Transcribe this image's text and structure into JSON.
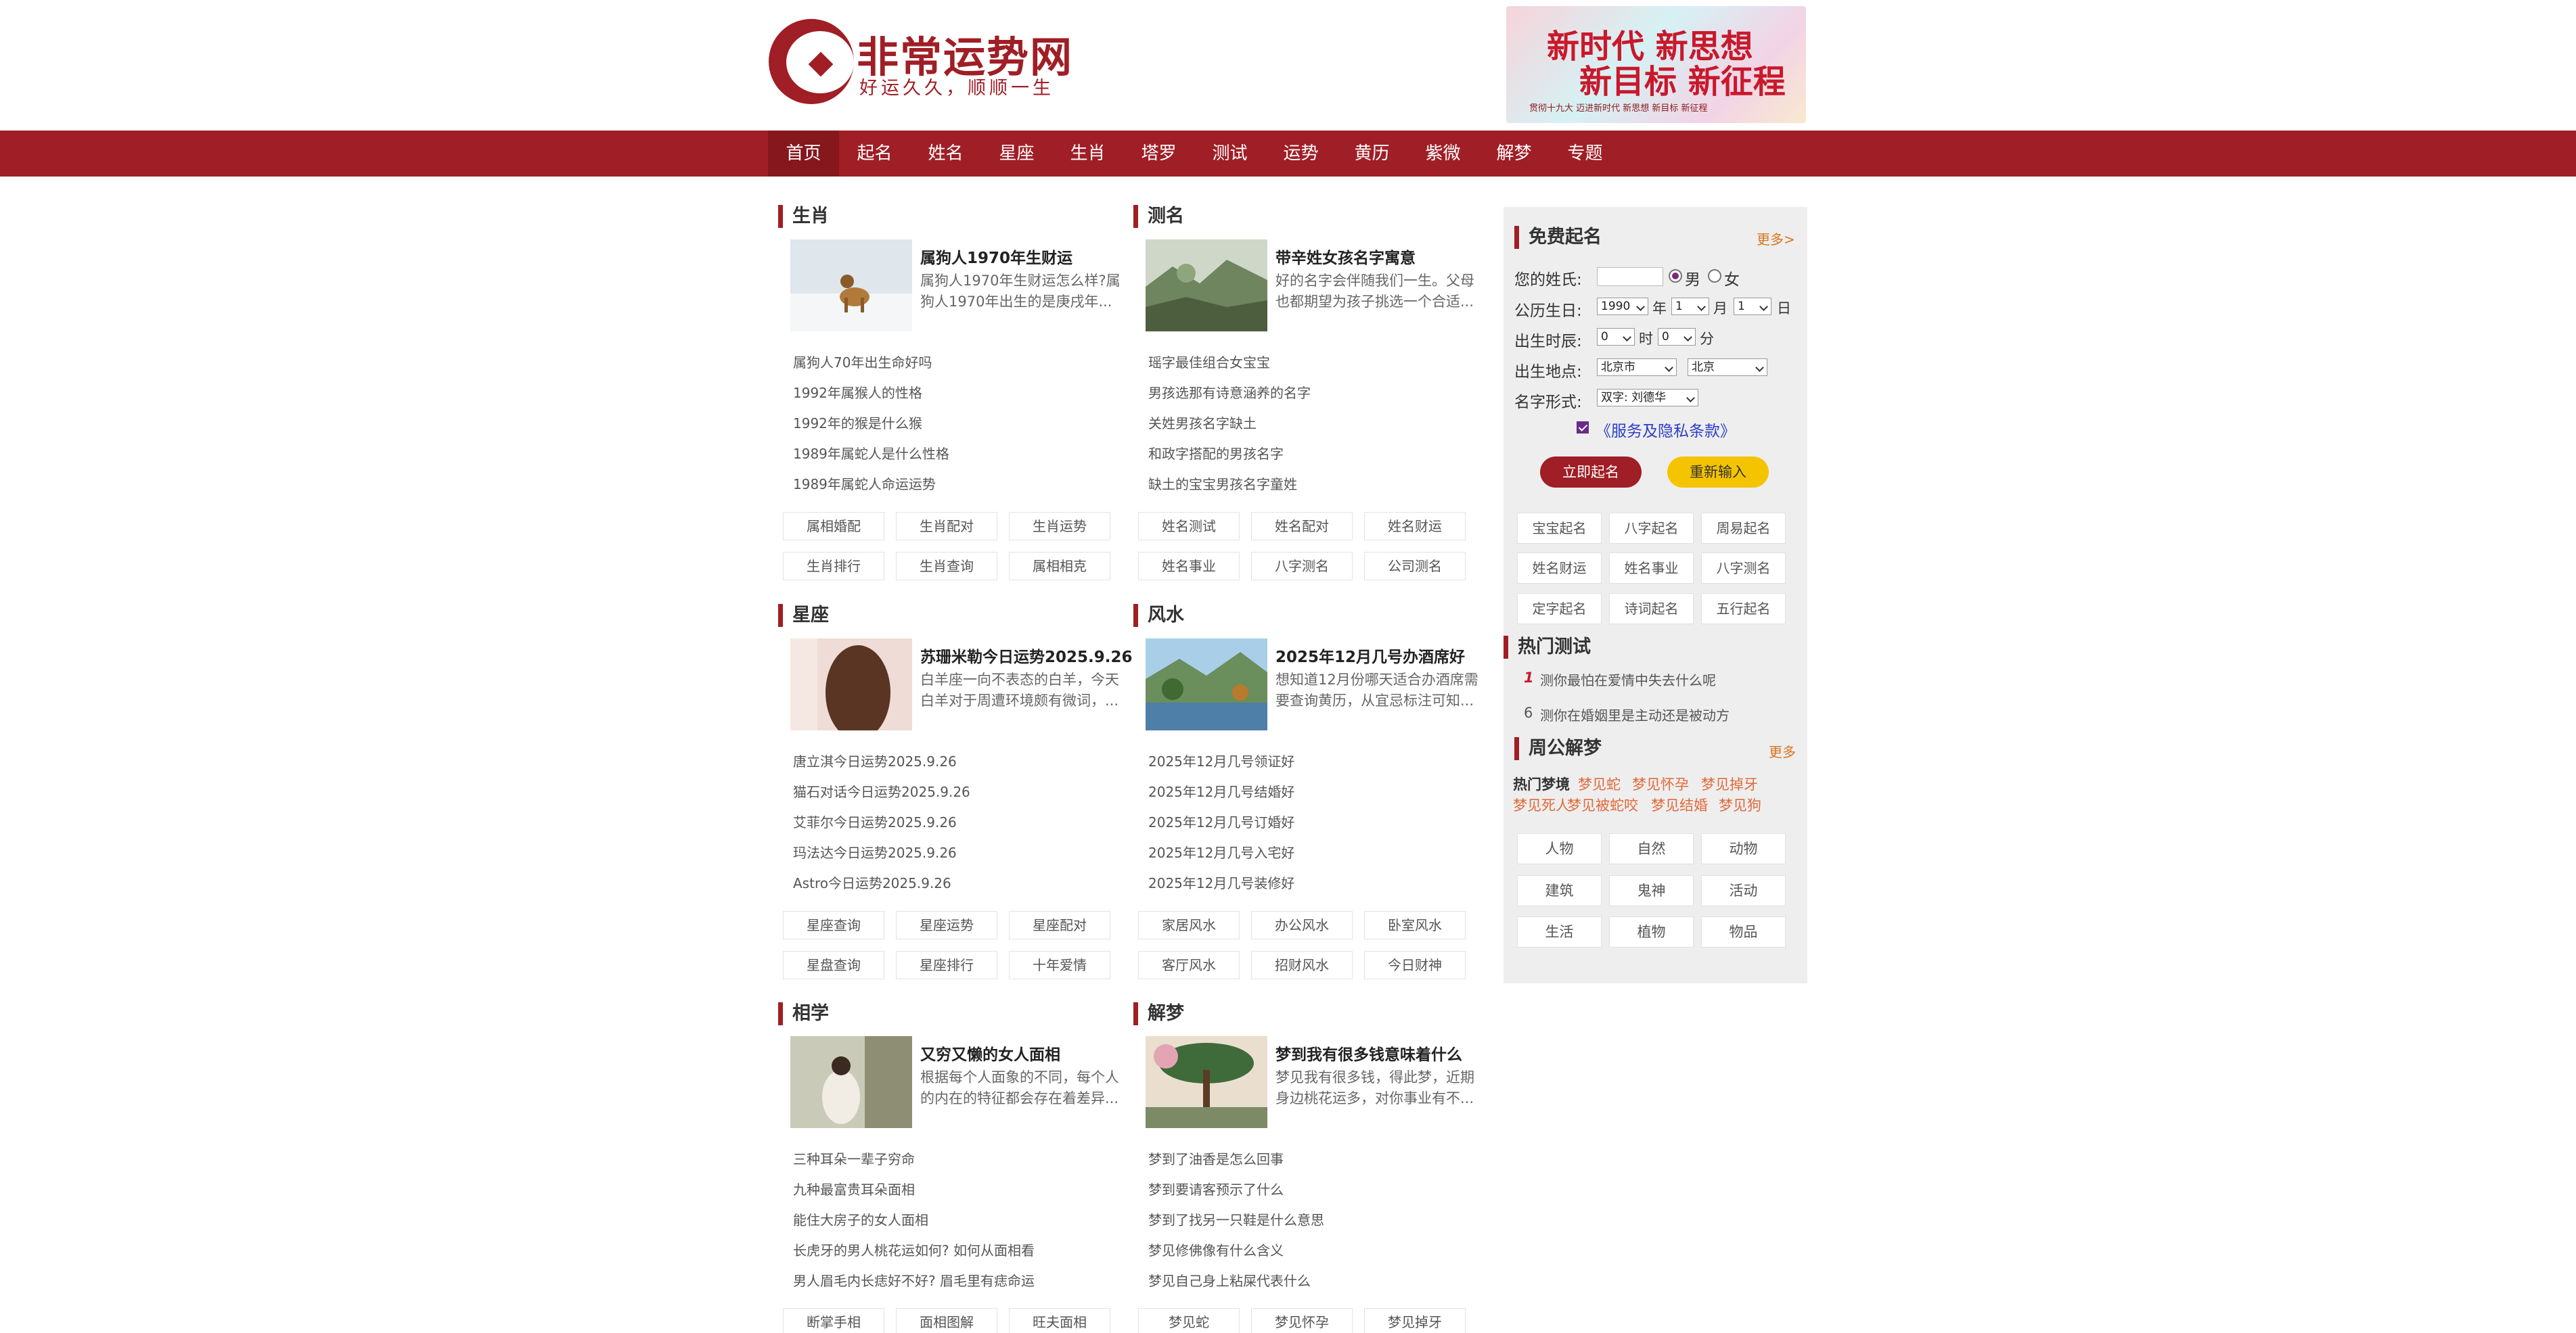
{
  "header": {
    "logo_title": "非常运势网",
    "logo_slogan": "好运久久，顺顺一生",
    "banner_line1": "新时代 新思想",
    "banner_line2": "新目标 新征程",
    "banner_sub": "贯彻十九大 迈进新时代 新思想 新目标 新征程"
  },
  "nav": {
    "items": [
      "首页",
      "起名",
      "姓名",
      "星座",
      "生肖",
      "塔罗",
      "测试",
      "运势",
      "黄历",
      "紫微",
      "解梦",
      "专题"
    ],
    "active_index": 0
  },
  "sections": {
    "shengxiao": {
      "title": "生肖",
      "feature_title": "属狗人1970年生财运",
      "feature_desc": "属狗人1970年生财运怎么样?属狗人1970年出生的是庚戌年...",
      "list": [
        "属狗人70年出生命好吗",
        "1992年属猴人的性格",
        "1992年的猴是什么猴",
        "1989年属蛇人是什么性格",
        "1989年属蛇人命运运势"
      ],
      "tags": [
        "属相婚配",
        "生肖配对",
        "生肖运势",
        "生肖排行",
        "生肖查询",
        "属相相克"
      ]
    },
    "ceming": {
      "title": "测名",
      "feature_title": "带辛姓女孩名字寓意",
      "feature_desc": "好的名字会伴随我们一生。父母也都期望为孩子挑选一个合适...",
      "list": [
        "瑶字最佳组合女宝宝",
        "男孩选那有诗意涵养的名字",
        "关姓男孩名字缺土",
        "和政字搭配的男孩名字",
        "缺土的宝宝男孩名字童姓"
      ],
      "tags": [
        "姓名测试",
        "姓名配对",
        "姓名财运",
        "姓名事业",
        "八字测名",
        "公司测名"
      ]
    },
    "xingzuo": {
      "title": "星座",
      "feature_title": "苏珊米勒今日运势2025.9.26",
      "feature_desc": "白羊座一向不表态的白羊，今天白羊对于周遭环境颇有微词，...",
      "list": [
        "唐立淇今日运势2025.9.26",
        "猫石对话今日运势2025.9.26",
        "艾菲尔今日运势2025.9.26",
        "玛法达今日运势2025.9.26",
        "Astro今日运势2025.9.26"
      ],
      "tags": [
        "星座查询",
        "星座运势",
        "星座配对",
        "星盘查询",
        "星座排行",
        "十年爱情"
      ]
    },
    "fengshui": {
      "title": "风水",
      "feature_title": "2025年12月几号办酒席好",
      "feature_desc": "想知道12月份哪天适合办酒席需要查询黄历，从宜忌标注可知...",
      "list": [
        "2025年12月几号领证好",
        "2025年12月几号结婚好",
        "2025年12月几号订婚好",
        "2025年12月几号入宅好",
        "2025年12月几号装修好"
      ],
      "tags": [
        "家居风水",
        "办公风水",
        "卧室风水",
        "客厅风水",
        "招财风水",
        "今日财神"
      ]
    },
    "xiangxue": {
      "title": "相学",
      "feature_title": "又穷又懒的女人面相",
      "feature_desc": "根据每个人面象的不同，每个人的内在的特征都会存在着差异...",
      "list": [
        "三种耳朵一辈子穷命",
        "九种最富贵耳朵面相",
        "能住大房子的女人面相",
        "长虎牙的男人桃花运如何? 如何从面相看",
        "男人眉毛内长痣好不好? 眉毛里有痣命运"
      ],
      "tags": [
        "断掌手相",
        "面相图解",
        "旺夫面相"
      ]
    },
    "jiemeng": {
      "title": "解梦",
      "feature_title": "梦到我有很多钱意味着什么",
      "feature_desc": "梦见我有很多钱，得此梦，近期身边桃花运多，对你事业有不...",
      "list": [
        "梦到了油香是怎么回事",
        "梦到要请客预示了什么",
        "梦到了找另一只鞋是什么意思",
        "梦见修佛像有什么含义",
        "梦见自己身上粘屎代表什么"
      ],
      "tags": [
        "梦见蛇",
        "梦见怀孕",
        "梦见掉牙"
      ]
    }
  },
  "sidebar": {
    "naming": {
      "title": "免费起名",
      "more": "更多>",
      "surname_label": "您的姓氏:",
      "surname_value": "",
      "gender_male": "男",
      "gender_female": "女",
      "birthday_label": "公历生日:",
      "year": "1990",
      "year_unit": "年",
      "month": "1",
      "month_unit": "月",
      "day": "1",
      "day_unit": "日",
      "time_label": "出生时辰:",
      "hour": "0",
      "hour_unit": "时",
      "minute": "0",
      "minute_unit": "分",
      "place_label": "出生地点:",
      "province": "北京市",
      "city": "北京",
      "form_label": "名字形式:",
      "form_value": "双字: 刘德华",
      "terms": "《服务及隐私条款》",
      "submit": "立即起名",
      "reset": "重新输入",
      "links": [
        "宝宝起名",
        "八字起名",
        "周易起名",
        "姓名财运",
        "姓名事业",
        "八字测名",
        "定字起名",
        "诗词起名",
        "五行起名"
      ]
    },
    "hot_test": {
      "title": "热门测试",
      "items": [
        {
          "rank": "1",
          "text": "测你最怕在爱情中失去什么呢"
        },
        {
          "rank": "6",
          "text": "测你在婚姻里是主动还是被动方"
        }
      ]
    },
    "dream": {
      "title": "周公解梦",
      "more": "更多",
      "hot_label": "热门梦境",
      "hot_items": [
        "梦见蛇",
        "梦见怀孕",
        "梦见掉牙",
        "梦见死人",
        "梦见被蛇咬",
        "梦见结婚",
        "梦见狗"
      ],
      "categories": [
        "人物",
        "自然",
        "动物",
        "建筑",
        "鬼神",
        "活动",
        "生活",
        "植物",
        "物品"
      ]
    }
  },
  "colors": {
    "brand_red": "#a01e25",
    "nav_active": "#86171d",
    "accent_orange": "#e06a3a",
    "button_yellow": "#f5c400",
    "sidebar_bg": "#eeeeee"
  }
}
